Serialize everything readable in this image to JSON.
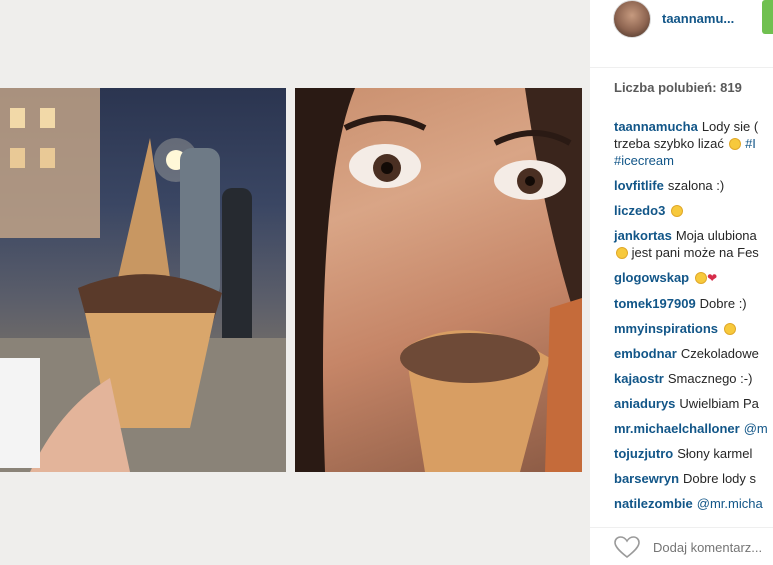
{
  "post": {
    "username": "taannamu...",
    "likes_text": "Liczba polubień: 819",
    "add_comment_placeholder": "Dodaj komentarz..."
  },
  "comments": [
    {
      "user": "taannamucha",
      "text": "Lody sie (",
      "text2": "trzeba szybko lizać",
      "tag1": "#I",
      "tag2": "#icecream"
    },
    {
      "user": "lovfitlife",
      "text": "szalona :)"
    },
    {
      "user": "liczedo3",
      "text": ""
    },
    {
      "user": "jankortas",
      "text": "Moja ulubiona",
      "text2": "jest pani może na Fes"
    },
    {
      "user": "glogowskap",
      "text": ""
    },
    {
      "user": "tomek197909",
      "text": "Dobre :)"
    },
    {
      "user": "mmyinspirations",
      "text": ""
    },
    {
      "user": "embodnar",
      "text": "Czekoladowe"
    },
    {
      "user": "kajaostr",
      "text": "Smacznego :-)"
    },
    {
      "user": "aniadurys",
      "text": "Uwielbiam Pa"
    },
    {
      "user": "mr.michaelchalloner",
      "text": "@m"
    },
    {
      "user": "tojuzjutro",
      "text": "Słony karmel"
    },
    {
      "user": "barsewryn",
      "text": "Dobre lody s"
    },
    {
      "user": "natilezombie",
      "text": "@mr.micha"
    }
  ],
  "colors": {
    "link": "#125688",
    "follow_button": "#70c050",
    "background": "#efeeec"
  }
}
